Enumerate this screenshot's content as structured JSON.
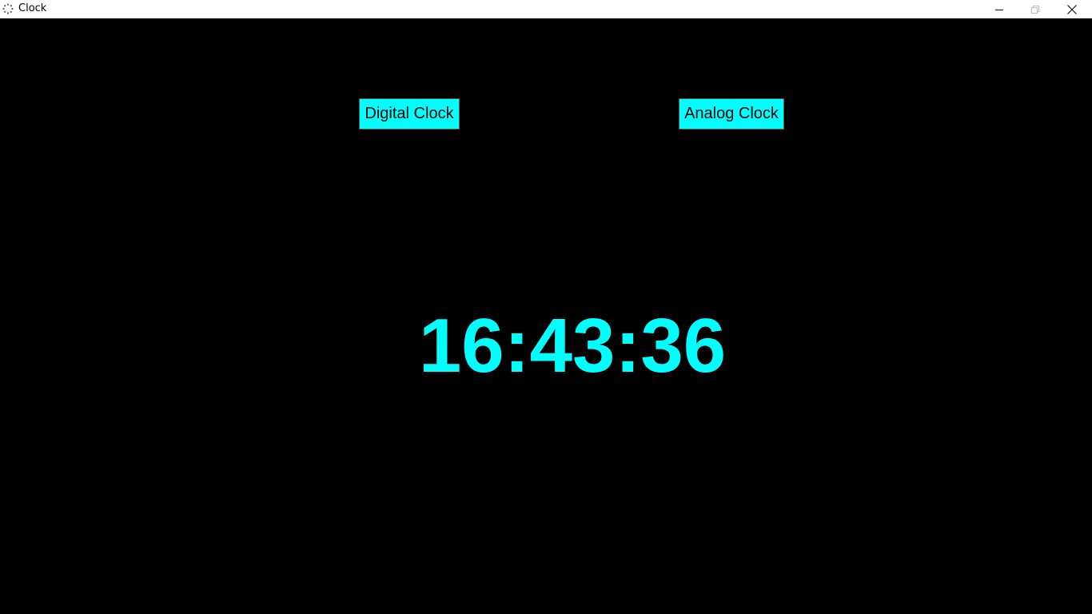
{
  "window": {
    "title": "Clock",
    "icon": "clock-loading-icon",
    "controls": {
      "minimize_icon": "minimize-icon",
      "maximize_icon": "restore-icon",
      "close_icon": "close-icon"
    }
  },
  "colors": {
    "background": "#000000",
    "accent": "#00ffff",
    "button_text": "#000000"
  },
  "buttons": {
    "digital_label": "Digital Clock",
    "analog_label": "Analog Clock"
  },
  "clock": {
    "time": "16:43:36"
  }
}
